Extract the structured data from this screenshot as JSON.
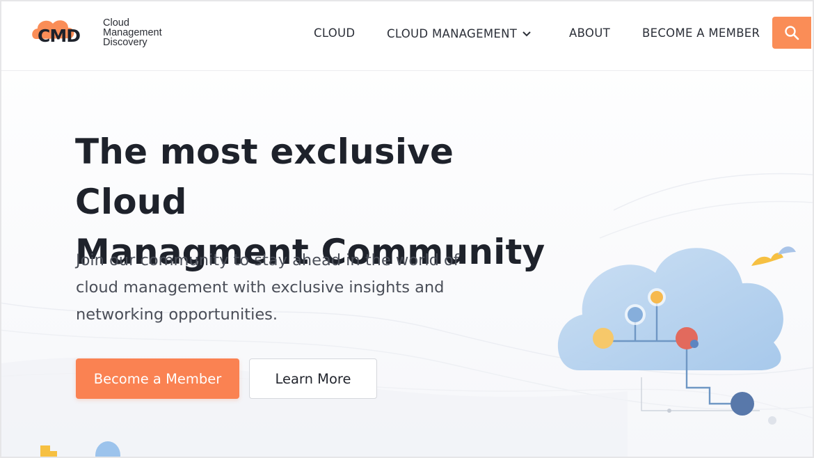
{
  "logo": {
    "mark_text": "CMD",
    "line1": "Cloud",
    "line2": "Management",
    "line3": "Discovery"
  },
  "nav": {
    "items": [
      {
        "label": "CLOUD"
      },
      {
        "label": "CLOUD MANAGEMENT",
        "has_dropdown": true
      },
      {
        "label": "ABOUT"
      },
      {
        "label": "BECOME A MEMBER"
      }
    ],
    "search_icon": "search-icon"
  },
  "hero": {
    "title_line1": "The most exclusive Cloud",
    "title_line2": "Managment Community",
    "subtitle_line1": "Join our community to stay ahead in the world of",
    "subtitle_line2": "cloud management with exclusive insights and",
    "subtitle_line3": "networking opportunities.",
    "primary_button": "Become a Member",
    "secondary_button": "Learn More"
  },
  "colors": {
    "accent": "#fa8252",
    "heading": "#1e222b",
    "cloud": "#a9cbea"
  }
}
